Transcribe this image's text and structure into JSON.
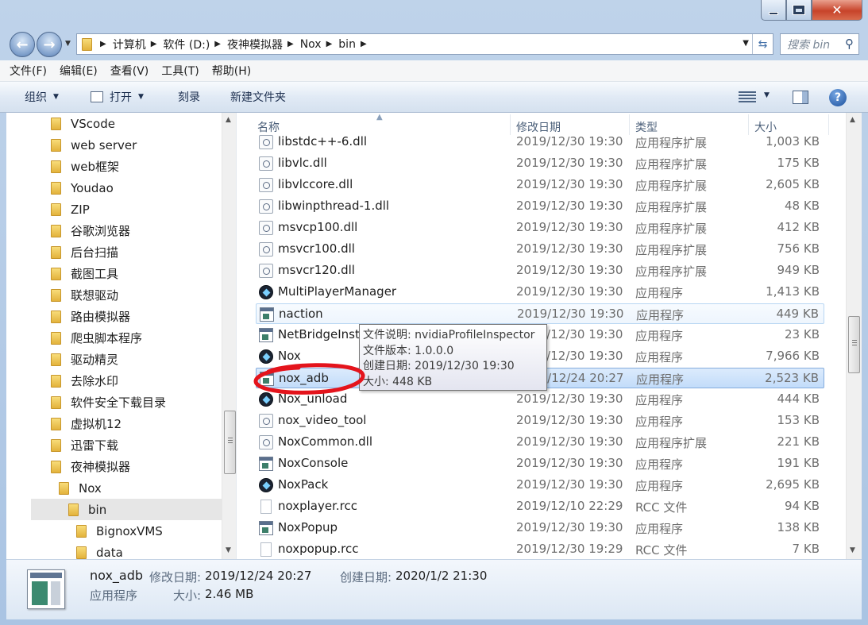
{
  "address": {
    "crumbs": [
      "计算机",
      "软件 (D:)",
      "夜神模拟器",
      "Nox",
      "bin"
    ],
    "search_placeholder": "搜索 bin"
  },
  "menu": [
    "文件(F)",
    "编辑(E)",
    "查看(V)",
    "工具(T)",
    "帮助(H)"
  ],
  "toolbar": {
    "organize": "组织",
    "open": "打开",
    "burn": "刻录",
    "new_folder": "新建文件夹"
  },
  "nav": {
    "items": [
      {
        "label": "VScode",
        "indent": 0
      },
      {
        "label": "web server",
        "indent": 0
      },
      {
        "label": "web框架",
        "indent": 0
      },
      {
        "label": "Youdao",
        "indent": 0
      },
      {
        "label": "ZIP",
        "indent": 0
      },
      {
        "label": "谷歌浏览器",
        "indent": 0
      },
      {
        "label": "后台扫描",
        "indent": 0
      },
      {
        "label": "截图工具",
        "indent": 0
      },
      {
        "label": "联想驱动",
        "indent": 0
      },
      {
        "label": "路由模拟器",
        "indent": 0
      },
      {
        "label": "爬虫脚本程序",
        "indent": 0
      },
      {
        "label": "驱动精灵",
        "indent": 0
      },
      {
        "label": "去除水印",
        "indent": 0
      },
      {
        "label": "软件安全下载目录",
        "indent": 0
      },
      {
        "label": "虚拟机12",
        "indent": 0
      },
      {
        "label": "迅雷下载",
        "indent": 0
      },
      {
        "label": "夜神模拟器",
        "indent": 0
      },
      {
        "label": "Nox",
        "indent": 1
      },
      {
        "label": "bin",
        "indent": 2,
        "selected": true
      },
      {
        "label": "BignoxVMS",
        "indent": 3
      },
      {
        "label": "data",
        "indent": 3
      }
    ]
  },
  "columns": {
    "name": "名称",
    "date": "修改日期",
    "type": "类型",
    "size": "大小"
  },
  "files": [
    {
      "name": "libstdc++-6.dll",
      "date": "2019/12/30 19:30",
      "type": "应用程序扩展",
      "size": "1,003 KB",
      "icon": "dll-icon"
    },
    {
      "name": "libvlc.dll",
      "date": "2019/12/30 19:30",
      "type": "应用程序扩展",
      "size": "175 KB",
      "icon": "dll-icon"
    },
    {
      "name": "libvlccore.dll",
      "date": "2019/12/30 19:30",
      "type": "应用程序扩展",
      "size": "2,605 KB",
      "icon": "dll-icon"
    },
    {
      "name": "libwinpthread-1.dll",
      "date": "2019/12/30 19:30",
      "type": "应用程序扩展",
      "size": "48 KB",
      "icon": "dll-icon"
    },
    {
      "name": "msvcp100.dll",
      "date": "2019/12/30 19:30",
      "type": "应用程序扩展",
      "size": "412 KB",
      "icon": "dll-icon"
    },
    {
      "name": "msvcr100.dll",
      "date": "2019/12/30 19:30",
      "type": "应用程序扩展",
      "size": "756 KB",
      "icon": "dll-icon"
    },
    {
      "name": "msvcr120.dll",
      "date": "2019/12/30 19:30",
      "type": "应用程序扩展",
      "size": "949 KB",
      "icon": "dll-icon"
    },
    {
      "name": "MultiPlayerManager",
      "date": "2019/12/30 19:30",
      "type": "应用程序",
      "size": "1,413 KB",
      "icon": "nox-icon"
    },
    {
      "name": "naction",
      "date": "2019/12/30 19:30",
      "type": "应用程序",
      "size": "449 KB",
      "icon": "exe-icon",
      "state": "hover"
    },
    {
      "name": "NetBridgeInst",
      "date": "2019/12/30 19:30",
      "type": "应用程序",
      "size": "23 KB",
      "icon": "exe-icon"
    },
    {
      "name": "Nox",
      "date": "2019/12/30 19:30",
      "type": "应用程序",
      "size": "7,966 KB",
      "icon": "nox-icon"
    },
    {
      "name": "nox_adb",
      "date": "2019/12/24 20:27",
      "type": "应用程序",
      "size": "2,523 KB",
      "icon": "exe-icon",
      "state": "sel"
    },
    {
      "name": "Nox_unload",
      "date": "2019/12/30 19:30",
      "type": "应用程序",
      "size": "444 KB",
      "icon": "nox-icon"
    },
    {
      "name": "nox_video_tool",
      "date": "2019/12/30 19:30",
      "type": "应用程序",
      "size": "153 KB",
      "icon": "dll-icon"
    },
    {
      "name": "NoxCommon.dll",
      "date": "2019/12/30 19:30",
      "type": "应用程序扩展",
      "size": "221 KB",
      "icon": "dll-icon"
    },
    {
      "name": "NoxConsole",
      "date": "2019/12/30 19:30",
      "type": "应用程序",
      "size": "191 KB",
      "icon": "exe-icon"
    },
    {
      "name": "NoxPack",
      "date": "2019/12/30 19:30",
      "type": "应用程序",
      "size": "2,695 KB",
      "icon": "nox-icon"
    },
    {
      "name": "noxplayer.rcc",
      "date": "2019/12/10 22:29",
      "type": "RCC 文件",
      "size": "94 KB",
      "icon": "rcc-icon"
    },
    {
      "name": "NoxPopup",
      "date": "2019/12/30 19:30",
      "type": "应用程序",
      "size": "138 KB",
      "icon": "exe-icon"
    },
    {
      "name": "noxpopup.rcc",
      "date": "2019/12/30 19:29",
      "type": "RCC 文件",
      "size": "7 KB",
      "icon": "rcc-icon"
    }
  ],
  "tooltip": [
    "文件说明: nvidiaProfileInspector",
    "文件版本: 1.0.0.0",
    "创建日期: 2019/12/30 19:30",
    "大小: 448 KB"
  ],
  "details": {
    "name": "nox_adb",
    "kind": "应用程序",
    "modified_label": "修改日期:",
    "modified_value": "2019/12/24 20:27",
    "created_label": "创建日期:",
    "created_value": "2020/1/2 21:30",
    "size_label": "大小:",
    "size_value": "2.46 MB"
  }
}
